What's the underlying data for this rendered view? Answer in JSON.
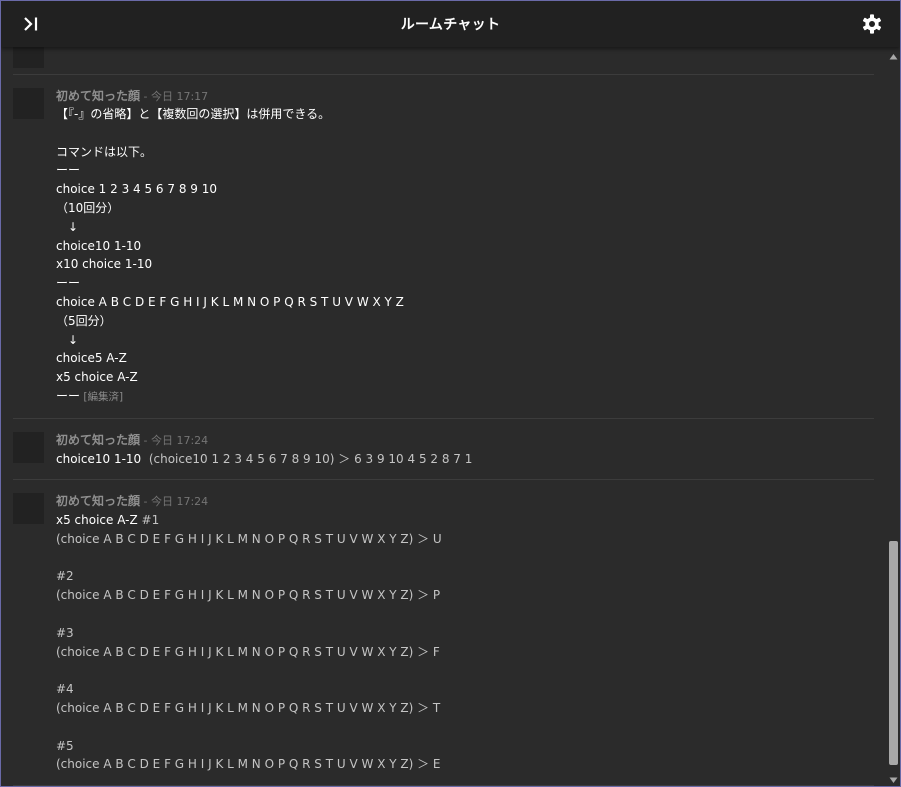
{
  "appbar": {
    "title": "ルームチャット",
    "collapse_icon": "panel-close-icon",
    "settings_icon": "gear-icon"
  },
  "messages": [
    {
      "sender": "初めて知った顔",
      "time": " - 今日 17:17",
      "lines": [
        {
          "main": "【『-』の省略】と【複数回の選択】は併用できる。"
        },
        {
          "main": ""
        },
        {
          "main": "コマンドは以下。"
        },
        {
          "main": "ーー"
        },
        {
          "main": "choice 1 2 3 4 5 6 7 8 9 10"
        },
        {
          "main": "（10回分）"
        },
        {
          "main": "　↓"
        },
        {
          "main": "choice10 1-10"
        },
        {
          "main": "x10 choice 1-10"
        },
        {
          "main": "ーー"
        },
        {
          "main": "choice A B C D E F G H I J K L M N O P Q R S T U V W X Y Z"
        },
        {
          "main": "（5回分）"
        },
        {
          "main": "　↓"
        },
        {
          "main": "choice5 A-Z"
        },
        {
          "main": "x5 choice A-Z"
        },
        {
          "main": "ーー",
          "edited": " [編集済]"
        }
      ]
    },
    {
      "sender": "初めて知った顔",
      "time": " - 今日 17:24",
      "lines": [
        {
          "main": "choice10 1-10",
          "result": "  (choice10 1 2 3 4 5 6 7 8 9 10) ＞ 6 3 9 10 4 5 2 8 7 1"
        }
      ]
    },
    {
      "sender": "初めて知った顔",
      "time": " - 今日 17:24",
      "lines": [
        {
          "main": "x5 choice A-Z",
          "hash": " #1"
        },
        {
          "result": "(choice A B C D E F G H I J K L M N O P Q R S T U V W X Y Z) ＞ U"
        },
        {
          "result": ""
        },
        {
          "result": "#2"
        },
        {
          "result": "(choice A B C D E F G H I J K L M N O P Q R S T U V W X Y Z) ＞ P"
        },
        {
          "result": ""
        },
        {
          "result": "#3"
        },
        {
          "result": "(choice A B C D E F G H I J K L M N O P Q R S T U V W X Y Z) ＞ F"
        },
        {
          "result": ""
        },
        {
          "result": "#4"
        },
        {
          "result": "(choice A B C D E F G H I J K L M N O P Q R S T U V W X Y Z) ＞ T"
        },
        {
          "result": ""
        },
        {
          "result": "#5"
        },
        {
          "result": "(choice A B C D E F G H I J K L M N O P Q R S T U V W X Y Z) ＞ E"
        }
      ]
    }
  ]
}
